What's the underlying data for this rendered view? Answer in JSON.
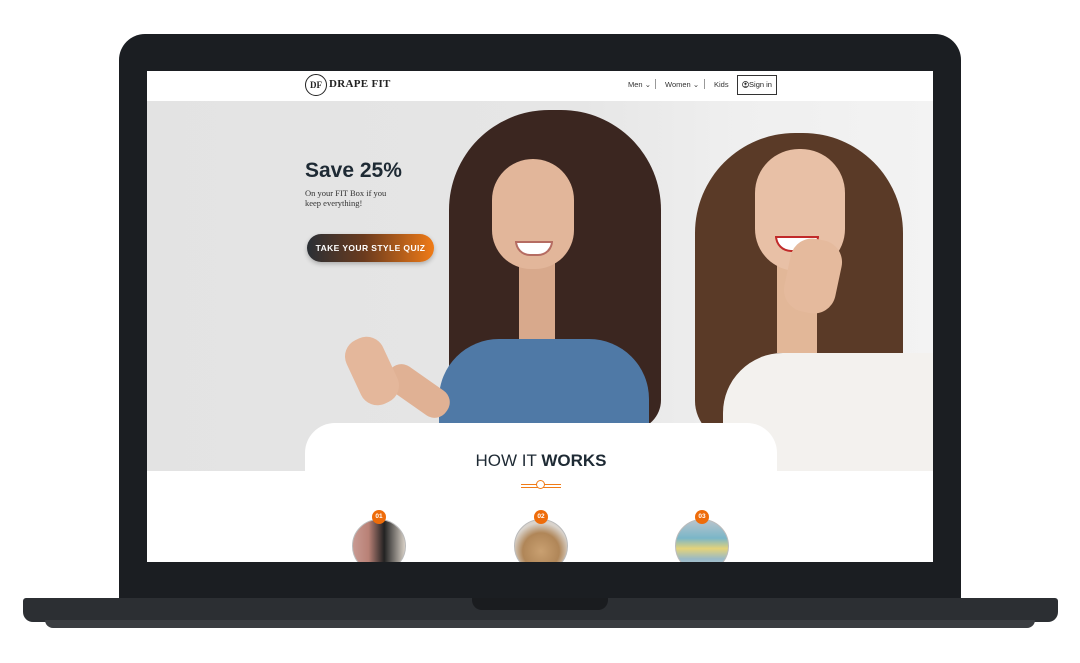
{
  "nav": {
    "logo_mark": "DF",
    "logo_text": "DRAPE FIT",
    "men": "Men",
    "women": "Women",
    "kids": "Kids",
    "signin": "Sign in"
  },
  "hero": {
    "title": "Save 25%",
    "subtitle": "On your FIT Box if you keep everything!",
    "cta": "TAKE YOUR STYLE QUIZ"
  },
  "how_it_works": {
    "title_light": "HOW IT ",
    "title_bold": "WORKS",
    "steps": [
      {
        "badge": "01"
      },
      {
        "badge": "02"
      },
      {
        "badge": "03"
      }
    ]
  },
  "colors": {
    "accent": "#f07b17",
    "dark": "#1e2a34"
  }
}
